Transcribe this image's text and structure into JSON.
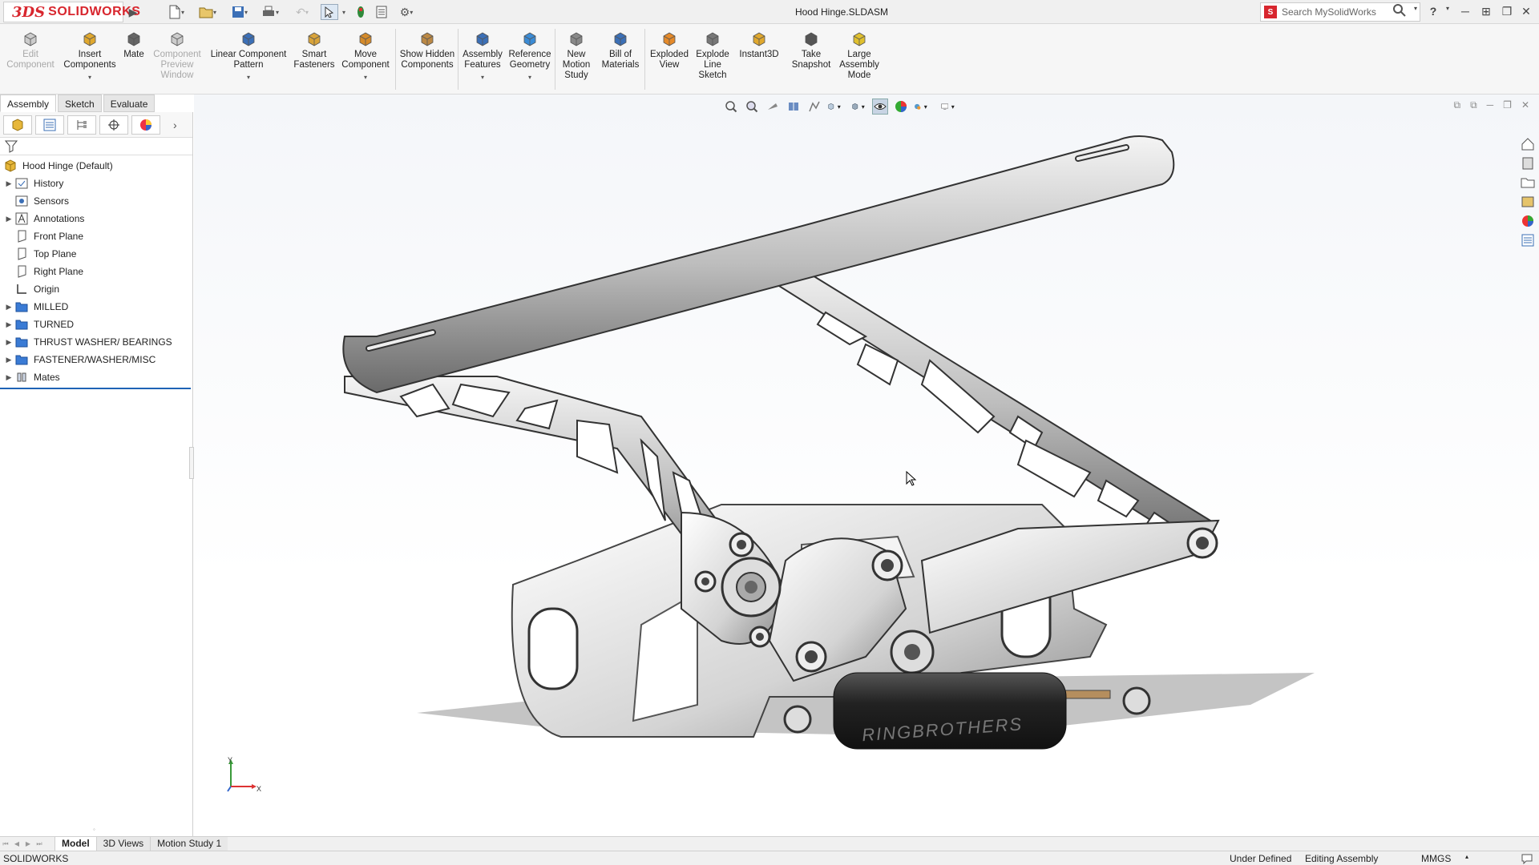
{
  "app": {
    "name": "SOLIDWORKS",
    "logo_mark": "3DS"
  },
  "title_bar": {
    "document_title": "Hood Hinge.SLDASM",
    "search_placeholder": "Search MySolidWorks",
    "help_label": "?"
  },
  "command_manager": {
    "tools": [
      {
        "label": "Edit Component",
        "icon": "edit-component-icon",
        "disabled": true
      },
      {
        "label": "Insert Components",
        "icon": "insert-components-icon",
        "disabled": false,
        "dropdown": true
      },
      {
        "label": "Mate",
        "icon": "mate-icon",
        "disabled": false
      },
      {
        "label": "Component Preview Window",
        "icon": "preview-window-icon",
        "disabled": true
      },
      {
        "label": "Linear Component Pattern",
        "icon": "linear-pattern-icon",
        "disabled": false,
        "dropdown": true
      },
      {
        "label": "Smart Fasteners",
        "icon": "smart-fasteners-icon",
        "disabled": false
      },
      {
        "label": "Move Component",
        "icon": "move-component-icon",
        "disabled": false,
        "dropdown": true
      },
      {
        "label": "Show Hidden Components",
        "icon": "show-hidden-icon",
        "disabled": false
      },
      {
        "label": "Assembly Features",
        "icon": "assembly-features-icon",
        "disabled": false,
        "dropdown": true
      },
      {
        "label": "Reference Geometry",
        "icon": "reference-geometry-icon",
        "disabled": false,
        "dropdown": true
      },
      {
        "label": "New Motion Study",
        "icon": "motion-study-icon",
        "disabled": false
      },
      {
        "label": "Bill of Materials",
        "icon": "bom-icon",
        "disabled": false
      },
      {
        "label": "Exploded View",
        "icon": "exploded-view-icon",
        "disabled": false
      },
      {
        "label": "Explode Line Sketch",
        "icon": "explode-line-icon",
        "disabled": false
      },
      {
        "label": "Instant3D",
        "icon": "instant3d-icon",
        "disabled": false
      },
      {
        "label": "Take Snapshot",
        "icon": "snapshot-icon",
        "disabled": false
      },
      {
        "label": "Large Assembly Mode",
        "icon": "large-assembly-icon",
        "disabled": false
      }
    ],
    "tabs": [
      "Assembly",
      "Sketch",
      "Evaluate"
    ],
    "active_tab": "Assembly"
  },
  "feature_tree": {
    "root": "Hood Hinge  (Default)",
    "items": [
      {
        "label": "History",
        "icon": "history-icon",
        "expandable": true
      },
      {
        "label": "Sensors",
        "icon": "sensors-icon",
        "expandable": false
      },
      {
        "label": "Annotations",
        "icon": "annotations-icon",
        "expandable": true
      },
      {
        "label": "Front Plane",
        "icon": "plane-icon",
        "expandable": false
      },
      {
        "label": "Top Plane",
        "icon": "plane-icon",
        "expandable": false
      },
      {
        "label": "Right Plane",
        "icon": "plane-icon",
        "expandable": false
      },
      {
        "label": "Origin",
        "icon": "origin-icon",
        "expandable": false
      },
      {
        "label": "MILLED",
        "icon": "folder-icon",
        "expandable": true
      },
      {
        "label": "TURNED",
        "icon": "folder-icon",
        "expandable": true
      },
      {
        "label": "THRUST WASHER/ BEARINGS",
        "icon": "folder-icon",
        "expandable": true
      },
      {
        "label": "FASTENER/WASHER/MISC",
        "icon": "folder-icon",
        "expandable": true
      },
      {
        "label": "Mates",
        "icon": "mates-icon",
        "expandable": true
      }
    ]
  },
  "model": {
    "brand_text": "RINGBROTHERS"
  },
  "triad": {
    "x": "X",
    "y": "Y"
  },
  "bottom_tabs": [
    "Model",
    "3D Views",
    "Motion Study 1"
  ],
  "status_bar": {
    "left": "SOLIDWORKS",
    "state": "Under Defined",
    "mode": "Editing Assembly",
    "units": "MMGS"
  },
  "colors": {
    "brand_red": "#d8262e",
    "tree_accent": "#1e63b5",
    "folder_blue": "#3a7bd5"
  }
}
